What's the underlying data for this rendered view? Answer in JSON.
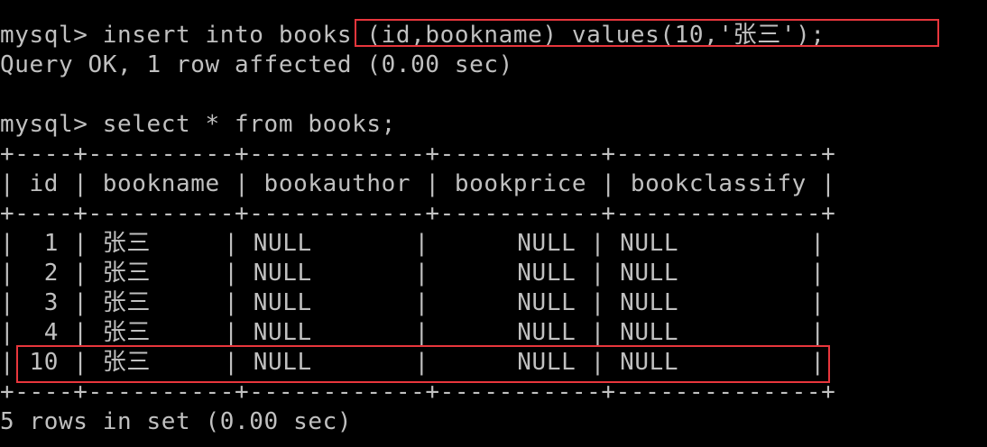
{
  "terminal": {
    "line_insert": "mysql> insert into books (id,bookname) values(10,'张三');",
    "line_insert_result": "Query OK, 1 row affected (0.00 sec)",
    "line_select": "mysql> select * from books;",
    "table_border_top": "+----+----------+------------+-----------+--------------+",
    "table_header": "| id | bookname | bookauthor | bookprice | bookclassify |",
    "table_border_mid": "+----+----------+------------+-----------+--------------+",
    "rows": [
      "|  1 | 张三     | NULL       |      NULL | NULL         |",
      "|  2 | 张三     | NULL       |      NULL | NULL         |",
      "|  3 | 张三     | NULL       |      NULL | NULL         |",
      "|  4 | 张三     | NULL       |      NULL | NULL         |",
      "| 10 | 张三     | NULL       |      NULL | NULL         |"
    ],
    "table_border_bottom": "+----+----------+------------+-----------+--------------+",
    "line_select_result": "5 rows in set (0.00 sec)"
  },
  "colors": {
    "background": "#000000",
    "text": "#c0c0c0",
    "highlight": "#e8363c"
  }
}
